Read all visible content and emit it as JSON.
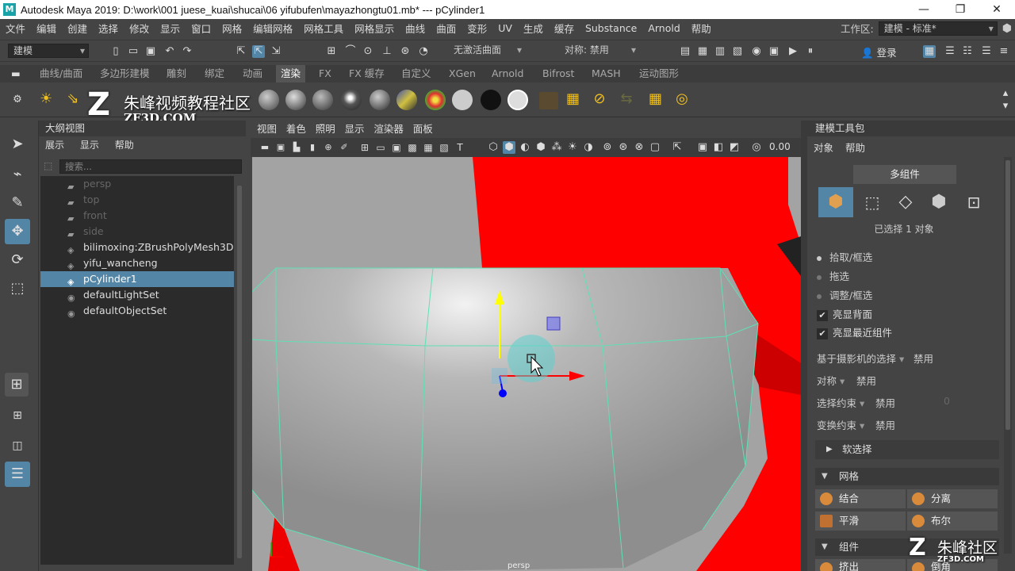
{
  "window": {
    "title": "Autodesk Maya 2019: D:\\work\\001 juese_kuai\\shucai\\06 yifubufen\\mayazhongtu01.mb*   ---   pCylinder1",
    "minimize": "—",
    "restore": "❐",
    "close": "✕"
  },
  "menubar": {
    "items": [
      "文件",
      "编辑",
      "创建",
      "选择",
      "修改",
      "显示",
      "窗口",
      "网格",
      "编辑网格",
      "网格工具",
      "网格显示",
      "曲线",
      "曲面",
      "变形",
      "UV",
      "生成",
      "缓存",
      "Substance",
      "Arnold",
      "帮助"
    ],
    "workspace_label": "工作区:",
    "workspace_value": "建模 - 标准*"
  },
  "statusline": {
    "mode": "建模",
    "live_surface": "无激活曲面",
    "symmetry": "对称: 禁用",
    "login": "登录"
  },
  "shelf": {
    "tabs": [
      "曲线/曲面",
      "多边形建模",
      "雕刻",
      "绑定",
      "动画",
      "渲染",
      "FX",
      "FX 缓存",
      "自定义",
      "XGen",
      "Arnold",
      "Bifrost",
      "MASH",
      "运动图形"
    ],
    "active_tab": "渲染"
  },
  "watermark": {
    "brand": "朱峰视频教程社区",
    "site": "ZF3D.COM",
    "corner_brand": "朱峰社区",
    "corner_site": "ZF3D.COM"
  },
  "outliner": {
    "title": "大纲视图",
    "menu": [
      "展示",
      "显示",
      "帮助"
    ],
    "search_placeholder": "搜索...",
    "items": [
      {
        "label": "persp",
        "icon": "camera-icon",
        "type": "camera"
      },
      {
        "label": "top",
        "icon": "camera-icon",
        "type": "camera"
      },
      {
        "label": "front",
        "icon": "camera-icon",
        "type": "camera"
      },
      {
        "label": "side",
        "icon": "camera-icon",
        "type": "camera"
      },
      {
        "label": "bilimoxing:ZBrushPolyMesh3D",
        "icon": "transform-icon",
        "type": "mesh"
      },
      {
        "label": "yifu_wancheng",
        "icon": "transform-icon",
        "type": "mesh"
      },
      {
        "label": "pCylinder1",
        "icon": "transform-icon",
        "type": "selected"
      },
      {
        "label": "defaultLightSet",
        "icon": "set-icon",
        "type": "set"
      },
      {
        "label": "defaultObjectSet",
        "icon": "set-icon",
        "type": "set"
      }
    ]
  },
  "viewport": {
    "menu": [
      "视图",
      "着色",
      "照明",
      "显示",
      "渲染器",
      "面板"
    ],
    "exposure_value": "0.00",
    "camera_label": "persp"
  },
  "modeling_toolkit": {
    "title": "建模工具包",
    "menu": [
      "对象",
      "帮助"
    ],
    "mode_button": "多组件",
    "selection_status": "已选择 1 对象",
    "radio_options": [
      "拾取/框选",
      "拖选",
      "调整/框选"
    ],
    "checkboxes": [
      "亮显背面",
      "亮显最近组件"
    ],
    "camera_based_selection_label": "基于摄影机的选择",
    "camera_based_selection_value": "禁用",
    "symmetry_label": "对称",
    "symmetry_value": "禁用",
    "selection_constraint_label": "选择约束",
    "selection_constraint_value": "禁用",
    "selection_constraint_number": "0",
    "transform_constraint_label": "变换约束",
    "transform_constraint_value": "禁用",
    "soft_select": "软选择",
    "mesh_section": "网格",
    "mesh_buttons": [
      "结合",
      "分离",
      "平滑",
      "布尔"
    ],
    "component_section": "组件",
    "component_buttons": [
      "挤出",
      "倒角"
    ]
  },
  "colors": {
    "accent_blue": "#5285a6",
    "viewport_bg": "#a3a3a3",
    "mesh_wire": "#5fe0b4"
  }
}
